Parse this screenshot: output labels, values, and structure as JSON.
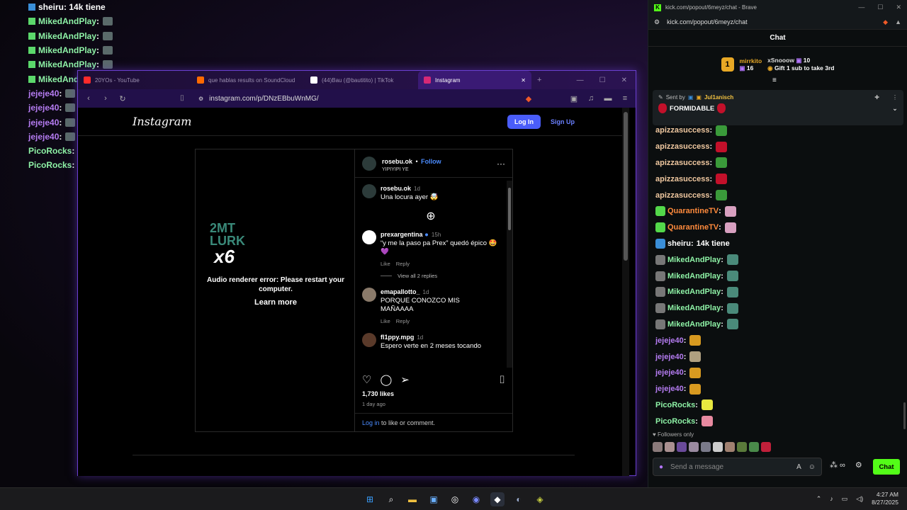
{
  "overlay_chat": [
    {
      "user": "sheiru",
      "text": ": 14k tiene",
      "color": "#ffffff",
      "badge": "#3a8ed8"
    },
    {
      "user": "MikedAndPlay",
      "text": " :",
      "color": "#8ef2a6",
      "badge": "#5bd86b"
    },
    {
      "user": "MikedAndPlay",
      "text": " :",
      "color": "#8ef2a6",
      "badge": "#5bd86b"
    },
    {
      "user": "MikedAndPlay",
      "text": " :",
      "color": "#8ef2a6",
      "badge": "#5bd86b"
    },
    {
      "user": "MikedAndPlay",
      "text": " :",
      "color": "#8ef2a6",
      "badge": "#5bd86b"
    },
    {
      "user": "MikedAndPlay",
      "text": " :",
      "color": "#8ef2a6",
      "badge": "#5bd86b"
    },
    {
      "user": "jejeje40",
      "text": " :",
      "color": "#b57cf2",
      "badge": ""
    },
    {
      "user": "jejeje40",
      "text": " :",
      "color": "#b57cf2",
      "badge": ""
    },
    {
      "user": "jejeje40",
      "text": " :",
      "color": "#b57cf2",
      "badge": ""
    },
    {
      "user": "jejeje40",
      "text": " :",
      "color": "#b57cf2",
      "badge": ""
    },
    {
      "user": "PicoRocks",
      "text": " :",
      "color": "#8ef2a6",
      "badge": ""
    },
    {
      "user": "PicoRocks",
      "text": " :",
      "color": "#8ef2a6",
      "badge": ""
    }
  ],
  "browser": {
    "tabs": [
      {
        "label": "20YOs - YouTube",
        "icon_color": "#ff2b2b"
      },
      {
        "label": "que hablas results on SoundCloud",
        "icon_color": "#ff6a00"
      },
      {
        "label": "(44)Bau (@bautitito) | TikTok",
        "icon_color": "#ffffff"
      },
      {
        "label": "Instagram",
        "icon_color": "#d62976"
      }
    ],
    "url": "instagram.com/p/DNzEBbuWnMG/"
  },
  "instagram": {
    "logo": "Instagram",
    "login": "Log In",
    "signup": "Sign Up",
    "media": {
      "emote_line1": "2MT",
      "emote_line2": "LURK",
      "emote_line3": "x6",
      "error_text": "Audio renderer error: Please restart your computer.",
      "learn_more": "Learn more"
    },
    "post_author": "rosebu.ok",
    "follow": "Follow",
    "post_sub": "YIPIYIPI YE",
    "comments": [
      {
        "user": "rosebu.ok",
        "time": "1d",
        "text": "Una locura ayer 🤯",
        "actions": false,
        "avatar": "#2c3b3a"
      },
      {
        "user": "prexargentina",
        "time": "15h",
        "text": "“y me la paso pa Prex” quedó épico 🤩 💜",
        "actions": true,
        "avatar": "#ffffff"
      },
      {
        "user": "emapallotto_",
        "time": "1d",
        "text": "PORQUE CONOZCO MIS MAÑAAAA",
        "actions": true,
        "avatar": "#8a7a6a"
      },
      {
        "user": "fl1ppy.mpg",
        "time": "1d",
        "text": "Espero verte en 2 meses tocando",
        "actions": false,
        "avatar": "#5a3a2a"
      }
    ],
    "like_label": "Like",
    "reply_label": "Reply",
    "view_replies": "View all 2 replies",
    "likes": "1,730 likes",
    "date": "1 day ago",
    "login_link": "Log in",
    "login_rest": " to like or comment."
  },
  "kick": {
    "window_title": "kick.com/popout/6meyz/chat - Brave",
    "url": "kick.com/popout/6meyz/chat",
    "header": "Chat",
    "gift": {
      "user1": "mirrkito",
      "count1": "16",
      "user2": "xSnooow",
      "count2": "10",
      "message": "Gift 1 sub to take 3rd"
    },
    "pinned": {
      "sent_by": "Sent by",
      "user": "Jul1anisch",
      "text": "FORMIDABLE"
    },
    "messages": [
      {
        "user": "apizzasuccess",
        "color": "#f0c8a0",
        "text": "",
        "emote": "#3a9a3a",
        "badge": ""
      },
      {
        "user": "apizzasuccess",
        "color": "#f0c8a0",
        "text": "",
        "emote": "#c2102a",
        "badge": ""
      },
      {
        "user": "apizzasuccess",
        "color": "#f0c8a0",
        "text": "",
        "emote": "#3a9a3a",
        "badge": ""
      },
      {
        "user": "apizzasuccess",
        "color": "#f0c8a0",
        "text": "",
        "emote": "#c2102a",
        "badge": ""
      },
      {
        "user": "apizzasuccess",
        "color": "#f0c8a0",
        "text": "",
        "emote": "#3a9a3a",
        "badge": ""
      },
      {
        "user": "QuarantineTV",
        "color": "#ff8a3c",
        "text": "",
        "emote": "#d8a0c0",
        "badge": "#53d84a"
      },
      {
        "user": "QuarantineTV",
        "color": "#ff8a3c",
        "text": "",
        "emote": "#d8a0c0",
        "badge": "#53d84a"
      },
      {
        "user": "sheiru",
        "color": "#ffffff",
        "text": "14k tiene",
        "emote": "",
        "badge": "#3a8ed8"
      },
      {
        "user": "MikedAndPlay",
        "color": "#8ef2a6",
        "text": "",
        "emote": "#4a8a7a",
        "badge": "#777777"
      },
      {
        "user": "MikedAndPlay",
        "color": "#8ef2a6",
        "text": "",
        "emote": "#4a8a7a",
        "badge": "#777777"
      },
      {
        "user": "MikedAndPlay",
        "color": "#8ef2a6",
        "text": "",
        "emote": "#4a8a7a",
        "badge": "#777777"
      },
      {
        "user": "MikedAndPlay",
        "color": "#8ef2a6",
        "text": "",
        "emote": "#4a8a7a",
        "badge": "#777777"
      },
      {
        "user": "MikedAndPlay",
        "color": "#8ef2a6",
        "text": "",
        "emote": "#4a8a7a",
        "badge": "#777777"
      },
      {
        "user": "jejeje40",
        "color": "#b57cf2",
        "text": "",
        "emote": "#d89a20",
        "badge": ""
      },
      {
        "user": "jejeje40",
        "color": "#b57cf2",
        "text": "",
        "emote": "#b0a080",
        "badge": ""
      },
      {
        "user": "jejeje40",
        "color": "#b57cf2",
        "text": "",
        "emote": "#d89a20",
        "badge": ""
      },
      {
        "user": "jejeje40",
        "color": "#b57cf2",
        "text": "",
        "emote": "#d89a20",
        "badge": ""
      },
      {
        "user": "PicoRocks",
        "color": "#8ef2a6",
        "text": "",
        "emote": "#e8e840",
        "badge": ""
      },
      {
        "user": "PicoRocks",
        "color": "#8ef2a6",
        "text": "",
        "emote": "#e88aa0",
        "badge": ""
      }
    ],
    "followers_only": "Followers only",
    "composer_placeholder": "Send a message",
    "send": "Chat"
  },
  "taskbar": {
    "time": "4:27 AM",
    "date": "8/27/2025"
  }
}
